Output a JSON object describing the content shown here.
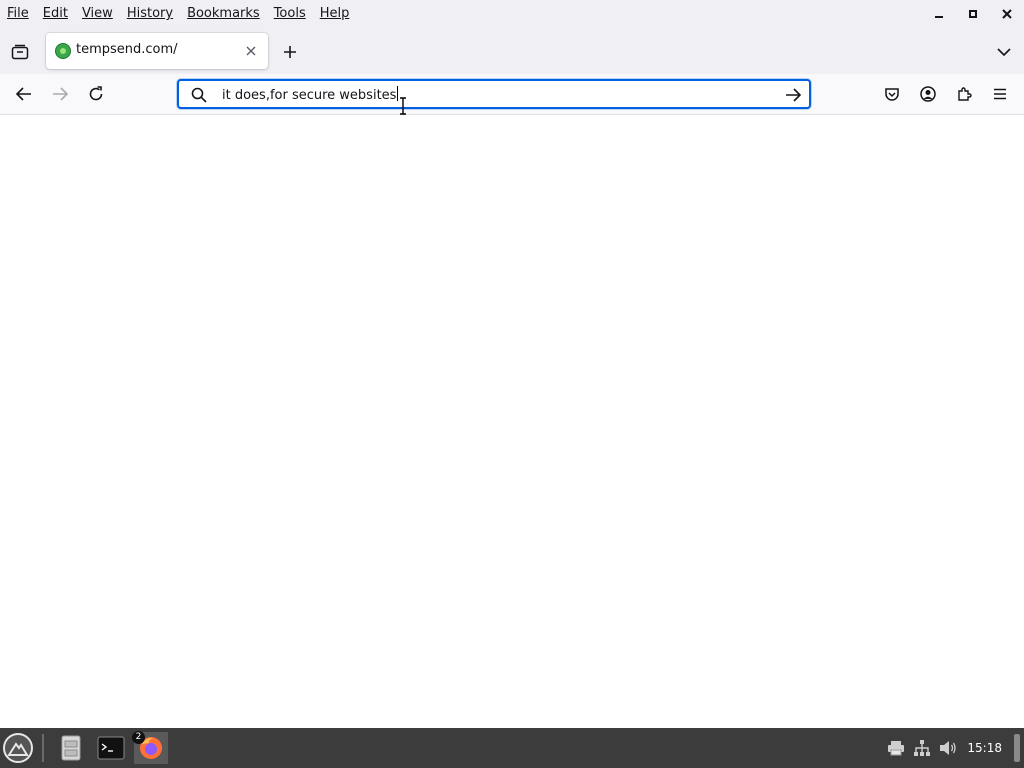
{
  "menubar": {
    "items": [
      {
        "label": "File"
      },
      {
        "label": "Edit"
      },
      {
        "label": "View"
      },
      {
        "label": "History"
      },
      {
        "label": "Bookmarks"
      },
      {
        "label": "Tools"
      },
      {
        "label": "Help"
      }
    ],
    "window_controls": [
      "minimize-icon",
      "maximize-icon",
      "close-icon"
    ]
  },
  "tabs": [
    {
      "title": "tempsend.com/",
      "favicon": "tempsend-favicon",
      "active": true
    }
  ],
  "navbar": {
    "back_icon": "arrow-left-icon",
    "forward_icon": "arrow-right-icon",
    "reload_icon": "reload-icon",
    "urlbar": {
      "value": "it does,for secure websites",
      "search_icon": "search-icon",
      "go_icon": "arrow-right-icon"
    },
    "right_icons": [
      "pocket-icon",
      "account-icon",
      "extensions-icon",
      "hamburger-menu-icon"
    ]
  },
  "taskbar": {
    "apps": [
      "file-manager-icon",
      "terminal-icon",
      "firefox-icon"
    ],
    "firefox_badge": "2",
    "tray_icons": [
      "printer-icon",
      "network-icon",
      "volume-icon"
    ],
    "clock": "15:18"
  },
  "colors": {
    "accent": "#0061e0",
    "chrome_bg": "#f0f0f4",
    "toolbar_bg": "#f9f9fb",
    "taskbar_bg": "#3c3c3c"
  }
}
